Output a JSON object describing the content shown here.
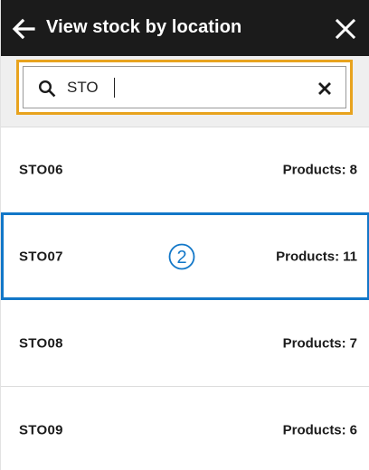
{
  "header": {
    "title": "View stock by location",
    "back_icon": "arrow-left-icon",
    "close_icon": "close-icon",
    "background": "#1b1b1b"
  },
  "search": {
    "value": "STO",
    "icon": "search-icon",
    "clear_icon": "clear-icon",
    "focus_color": "#e8a31e"
  },
  "locations": [
    {
      "code": "STO06",
      "products_label": "Products:",
      "count": "8"
    },
    {
      "code": "STO07",
      "products_label": "Products:",
      "count": "11",
      "selected": true,
      "step": "2"
    },
    {
      "code": "STO08",
      "products_label": "Products:",
      "count": "7"
    },
    {
      "code": "STO09",
      "products_label": "Products:",
      "count": "6"
    }
  ],
  "selection_color": "#1277c8"
}
